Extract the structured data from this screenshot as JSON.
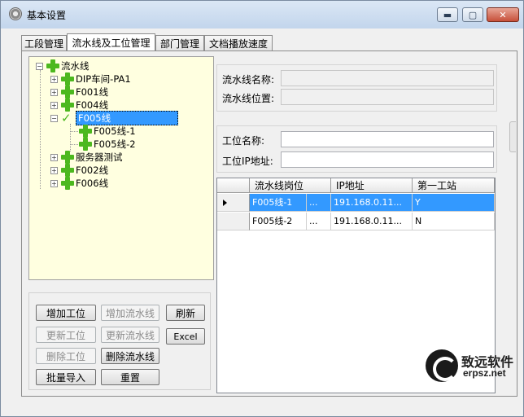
{
  "window": {
    "title": "基本设置",
    "minimize_glyph": "▬",
    "maximize_glyph": "▢",
    "close_glyph": "✕"
  },
  "tabs": [
    {
      "label": "工段管理"
    },
    {
      "label": "流水线及工位管理",
      "active": true
    },
    {
      "label": "部门管理"
    },
    {
      "label": "文档播放速度"
    }
  ],
  "tree": {
    "root": {
      "label": "流水线",
      "icon": "plus-icon"
    },
    "nodes": [
      {
        "label": "DIP车间-PA1",
        "icon": "plus-icon",
        "expander": "+"
      },
      {
        "label": "F001线",
        "icon": "plus-icon",
        "expander": "+"
      },
      {
        "label": "F004线",
        "icon": "plus-icon",
        "expander": "+"
      },
      {
        "label": "F005线",
        "icon": "check-icon",
        "expander": "−",
        "selected": true
      },
      {
        "label": "F005线-1",
        "icon": "plus-icon",
        "child": true
      },
      {
        "label": "F005线-2",
        "icon": "plus-icon",
        "child": true
      },
      {
        "label": "服务器测试",
        "icon": "plus-icon",
        "expander": "+"
      },
      {
        "label": "F002线",
        "icon": "plus-icon",
        "expander": "+"
      },
      {
        "label": "F006线",
        "icon": "plus-icon",
        "expander": "+"
      }
    ]
  },
  "buttons": {
    "add_station": "增加工位",
    "add_line": "增加流水线",
    "refresh": "刷新",
    "update_station": "更新工位",
    "update_line": "更新流水线",
    "excel": "Excel",
    "delete_station": "删除工位",
    "delete_line": "删除流水线",
    "batch_import": "批量导入",
    "reset": "重置"
  },
  "line_form": {
    "name_label": "流水线名称:",
    "name_value": "",
    "position_label": "流水线位置:",
    "position_value": ""
  },
  "station_form": {
    "name_label": "工位名称:",
    "name_value": "",
    "ip_label": "工位IP地址:",
    "ip_value": ""
  },
  "grid": {
    "columns": [
      "流水线岗位",
      "IP地址",
      "第一工站"
    ],
    "rows": [
      {
        "post": "F005线-1",
        "ellipsis": "...",
        "ip": "191.168.0.11...",
        "first": "Y",
        "selected": true
      },
      {
        "post": "F005线-2",
        "ellipsis": "...",
        "ip": "191.168.0.11...",
        "first": "N",
        "selected": false
      }
    ]
  },
  "watermark": {
    "cn": "致远软件",
    "en": "erpsz.net"
  }
}
